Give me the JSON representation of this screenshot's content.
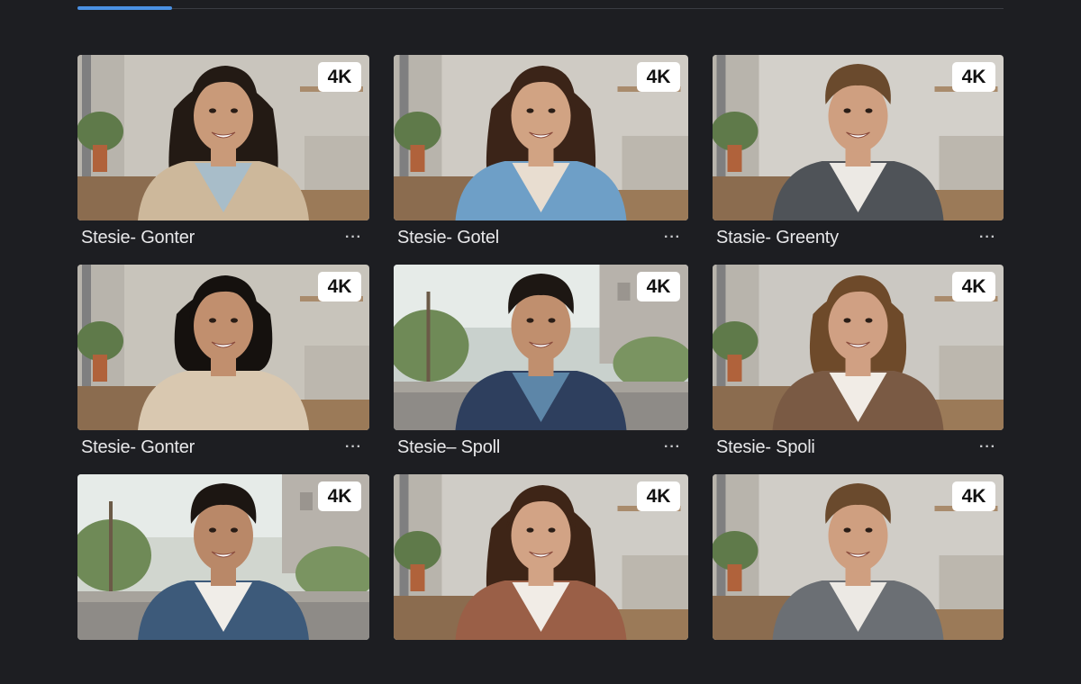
{
  "tabs": {
    "active_tab_color": "#4a90e2"
  },
  "videos": [
    {
      "name": "Stesie- Gonter",
      "badge": "4K",
      "background": "office",
      "bg_color": "#c9c5bd",
      "hair_color": "#231a14",
      "shirt_color": "#a8bdc9",
      "jacket_color": "#cdb89b",
      "skin_color": "#c99a79",
      "hair_style": "long"
    },
    {
      "name": "Stesie- Gotel",
      "badge": "4K",
      "background": "office",
      "bg_color": "#cfcbc4",
      "hair_color": "#3b2418",
      "shirt_color": "#e8ddd0",
      "jacket_color": "#6e9fc7",
      "skin_color": "#d1a383",
      "hair_style": "long"
    },
    {
      "name": "Stasie- Greenty",
      "badge": "4K",
      "background": "office",
      "bg_color": "#d3d0ca",
      "hair_color": "#6a4a2d",
      "shirt_color": "#ece9e4",
      "jacket_color": "#4f5358",
      "skin_color": "#cf9f80",
      "hair_style": "short"
    },
    {
      "name": "Stesie- Gonter",
      "badge": "4K",
      "background": "office",
      "bg_color": "#c8c4bb",
      "hair_color": "#15110e",
      "shirt_color": "#d9c8b0",
      "jacket_color": "#d9c8b0",
      "skin_color": "#c18f6e",
      "hair_style": "bob"
    },
    {
      "name": "Stesie– Spoll",
      "badge": "4K",
      "background": "street",
      "bg_color": "#c9d1cd",
      "hair_color": "#1d1713",
      "shirt_color": "#5d86a8",
      "jacket_color": "#2e3f5e",
      "skin_color": "#c08f6e",
      "hair_style": "short"
    },
    {
      "name": "Stesie- Spoli",
      "badge": "4K",
      "background": "office",
      "bg_color": "#cbc8c2",
      "hair_color": "#6e4a2a",
      "shirt_color": "#f1ece6",
      "jacket_color": "#7a5a44",
      "skin_color": "#d0a083",
      "hair_style": "medium"
    },
    {
      "name": "",
      "badge": "4K",
      "background": "street",
      "bg_color": "#d1d6cf",
      "hair_color": "#1c1612",
      "shirt_color": "#f0ede8",
      "jacket_color": "#3d5a7a",
      "skin_color": "#b98868",
      "hair_style": "curly"
    },
    {
      "name": "",
      "badge": "4K",
      "background": "office",
      "bg_color": "#cfccc6",
      "hair_color": "#3e2517",
      "shirt_color": "#f1ece6",
      "jacket_color": "#9a5f47",
      "skin_color": "#d2a385",
      "hair_style": "long"
    },
    {
      "name": "",
      "badge": "4K",
      "background": "office",
      "bg_color": "#d0cdc7",
      "hair_color": "#6a4a2d",
      "shirt_color": "#ece9e4",
      "jacket_color": "#6b6f74",
      "skin_color": "#cf9f80",
      "hair_style": "short"
    }
  ]
}
